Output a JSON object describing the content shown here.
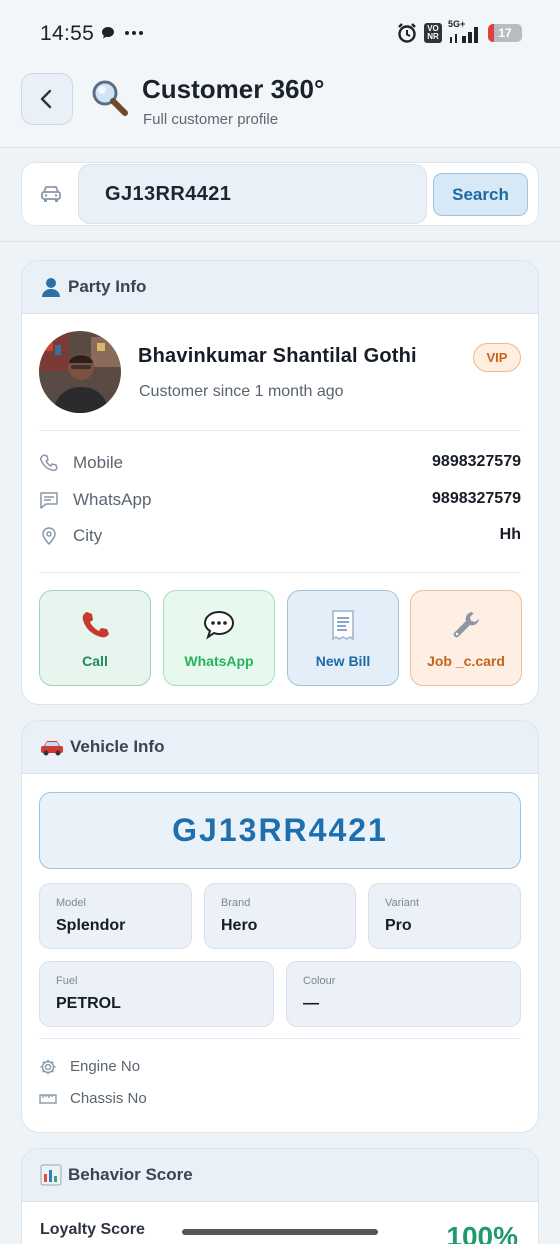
{
  "status_bar": {
    "time": "14:55",
    "network": "5G+",
    "battery": "17",
    "vonr": "VO NR"
  },
  "header": {
    "title": "Customer 360°",
    "subtitle": "Full customer profile"
  },
  "search": {
    "value": "GJ13RR4421",
    "button_label": "Search"
  },
  "party": {
    "title": "Party Info",
    "name": "Bhavinkumar Shantilal Gothi",
    "badge": "VIP",
    "since": "Customer since 1 month ago",
    "rows": [
      {
        "label": "Mobile",
        "value": "9898327579",
        "icon": "phone-icon"
      },
      {
        "label": "WhatsApp",
        "value": "9898327579",
        "icon": "chat-icon"
      },
      {
        "label": "City",
        "value": "Hh",
        "icon": "location-pin-icon"
      }
    ],
    "actions": [
      {
        "label": "Call",
        "icon": "telephone-icon",
        "color": "#1f8a5a"
      },
      {
        "label": "WhatsApp",
        "icon": "speech-bubble-icon",
        "color": "#27b35e"
      },
      {
        "label": "New Bill",
        "icon": "receipt-icon",
        "color": "#1c6aa3"
      },
      {
        "label": "Job _c.card",
        "icon": "wrench-icon",
        "color": "#c9621c"
      }
    ]
  },
  "vehicle": {
    "title": "Vehicle Info",
    "plate": "GJ13RR4421",
    "fields": [
      {
        "label": "Model",
        "value": "Splendor"
      },
      {
        "label": "Brand",
        "value": "Hero"
      },
      {
        "label": "Variant",
        "value": "Pro"
      },
      {
        "label": "Fuel",
        "value": "PETROL"
      },
      {
        "label": "Colour",
        "value": "—"
      }
    ],
    "rows": [
      {
        "label": "Engine No",
        "icon": "gear-icon"
      },
      {
        "label": "Chassis No",
        "icon": "ruler-icon"
      }
    ]
  },
  "behavior": {
    "title": "Behavior Score",
    "loyalty_label": "Loyalty Score",
    "loyalty_value": "100%"
  }
}
